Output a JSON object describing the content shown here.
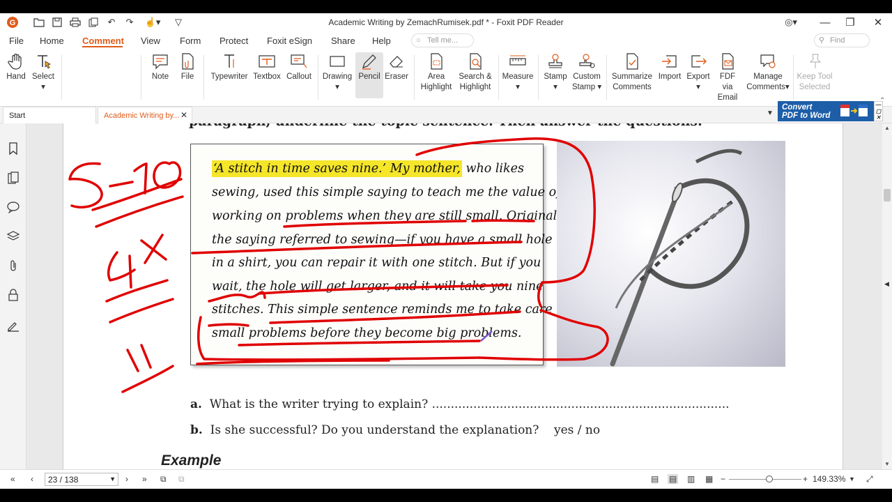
{
  "window": {
    "title": "Academic Writing by ZemachRumisek.pdf * - Foxit PDF Reader"
  },
  "menu": {
    "file": "File",
    "home": "Home",
    "comment": "Comment",
    "view": "View",
    "form": "Form",
    "protect": "Protect",
    "esign": "Foxit eSign",
    "share": "Share",
    "help": "Help",
    "tell_me_placeholder": "Tell me...",
    "find_placeholder": "Find"
  },
  "ribbon": {
    "hand": "Hand",
    "select": "Select",
    "note": "Note",
    "file": "File",
    "typewriter": "Typewriter",
    "textbox": "Textbox",
    "callout": "Callout",
    "drawing": "Drawing",
    "pencil": "Pencil",
    "eraser": "Eraser",
    "area_highlight_1": "Area",
    "area_highlight_2": "Highlight",
    "search_highlight_1": "Search &",
    "search_highlight_2": "Highlight",
    "measure": "Measure",
    "stamp": "Stamp",
    "custom_stamp_1": "Custom",
    "custom_stamp_2": "Stamp",
    "summarize_1": "Summarize",
    "summarize_2": "Comments",
    "import": "Import",
    "export": "Export",
    "fdf_1": "FDF via",
    "fdf_2": "Email",
    "manage_1": "Manage",
    "manage_2": "Comments",
    "keep_1": "Keep Tool",
    "keep_2": "Selected"
  },
  "tabs": {
    "start": "Start",
    "doc": "Academic Writing by..."
  },
  "convert": {
    "line1": "Convert",
    "line2": "PDF to Word"
  },
  "document": {
    "top_text": "paragraph, underline the topic sentence. Then answer the questions.",
    "highlighted": "‘A stitch in time saves nine.’ My mother,",
    "lines": [
      " who likes",
      "sewing, used this simple saying to teach me the value of",
      "working on problems when they are still small. Originally,",
      "the saying referred to sewing—if you have a small hole",
      "in a shirt, you can repair it with one stitch. But if you",
      "wait, the hole will get larger, and it will take you nine",
      "stitches. This simple sentence reminds me to take care of",
      "small problems before they become big problems."
    ],
    "q_a_letter": "a.",
    "q_a": "What is the writer trying to explain? ...............................................................................",
    "q_b_letter": "b.",
    "q_b": "Is she successful? Do you understand the explanation?",
    "q_b_answer": "yes / no",
    "example": "Example"
  },
  "status": {
    "page": "23 / 138",
    "zoom": "149.33%"
  },
  "colors": {
    "accent": "#e05b1a",
    "highlight": "#f5e62a",
    "ink": "#e00000",
    "convert_bg": "#1e5ea8"
  }
}
